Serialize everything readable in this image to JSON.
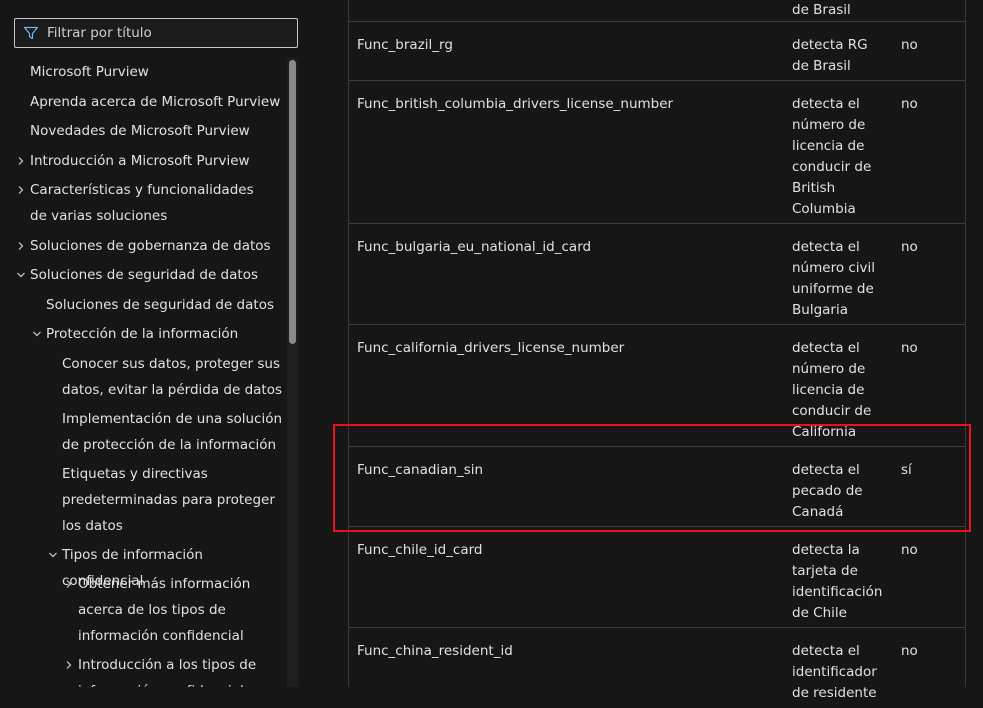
{
  "filter": {
    "placeholder": "Filtrar por título",
    "icon": "filter-icon"
  },
  "nav": {
    "items": [
      {
        "label": "Microsoft Purview",
        "level": 0,
        "expander": "none"
      },
      {
        "label": "Aprenda acerca de Microsoft Purview",
        "level": 0,
        "expander": "none"
      },
      {
        "label": "Novedades de Microsoft Purview",
        "level": 0,
        "expander": "none"
      },
      {
        "label": "Introducción a Microsoft Purview",
        "level": 0,
        "expander": "collapsed"
      },
      {
        "label": "Características y funcionalidades de varias soluciones",
        "level": 0,
        "expander": "collapsed"
      },
      {
        "label": "Soluciones de gobernanza de datos",
        "level": 0,
        "expander": "collapsed"
      },
      {
        "label": "Soluciones de seguridad de datos",
        "level": 0,
        "expander": "expanded"
      },
      {
        "label": "Soluciones de seguridad de datos",
        "level": 1,
        "expander": "none"
      },
      {
        "label": "Protección de la información",
        "level": 1,
        "expander": "expanded"
      },
      {
        "label": "Conocer sus datos, proteger sus datos, evitar la pérdida de datos",
        "level": 2,
        "expander": "none"
      },
      {
        "label": "Implementación de una solución de protección de la información",
        "level": 2,
        "expander": "none"
      },
      {
        "label": "Etiquetas y directivas predeterminadas para proteger los datos",
        "level": 2,
        "expander": "none"
      },
      {
        "label": "Tipos de información confidencial",
        "level": 2,
        "expander": "expanded"
      },
      {
        "label": "Obtener más información acerca de los tipos de información confidencial",
        "level": 3,
        "expander": "collapsed"
      },
      {
        "label": "Introducción a los tipos de información confidencial",
        "level": 3,
        "expander": "collapsed"
      }
    ]
  },
  "table": {
    "rows": [
      {
        "name": "",
        "desc": "de Brasil",
        "flag": ""
      },
      {
        "name": "Func_brazil_rg",
        "desc": "detecta RG de Brasil",
        "flag": "no"
      },
      {
        "name": "Func_british_columbia_drivers_license_number",
        "desc": "detecta el número de licencia de conducir de British Columbia",
        "flag": "no"
      },
      {
        "name": "Func_bulgaria_eu_national_id_card",
        "desc": "detecta el número civil uniforme de Bulgaria",
        "flag": "no"
      },
      {
        "name": "Func_california_drivers_license_number",
        "desc": "detecta el número de licencia de conducir de California",
        "flag": "no"
      },
      {
        "name": "Func_canadian_sin",
        "desc": "detecta el pecado de Canadá",
        "flag": "sí"
      },
      {
        "name": "Func_chile_id_card",
        "desc": "detecta la tarjeta de identificación de Chile",
        "flag": "no"
      },
      {
        "name": "Func_china_resident_id",
        "desc": "detecta el identificador de residente",
        "flag": "no"
      }
    ]
  },
  "colors": {
    "background": "#161616",
    "text": "#e1e1e1",
    "highlight": "#e8121f"
  }
}
